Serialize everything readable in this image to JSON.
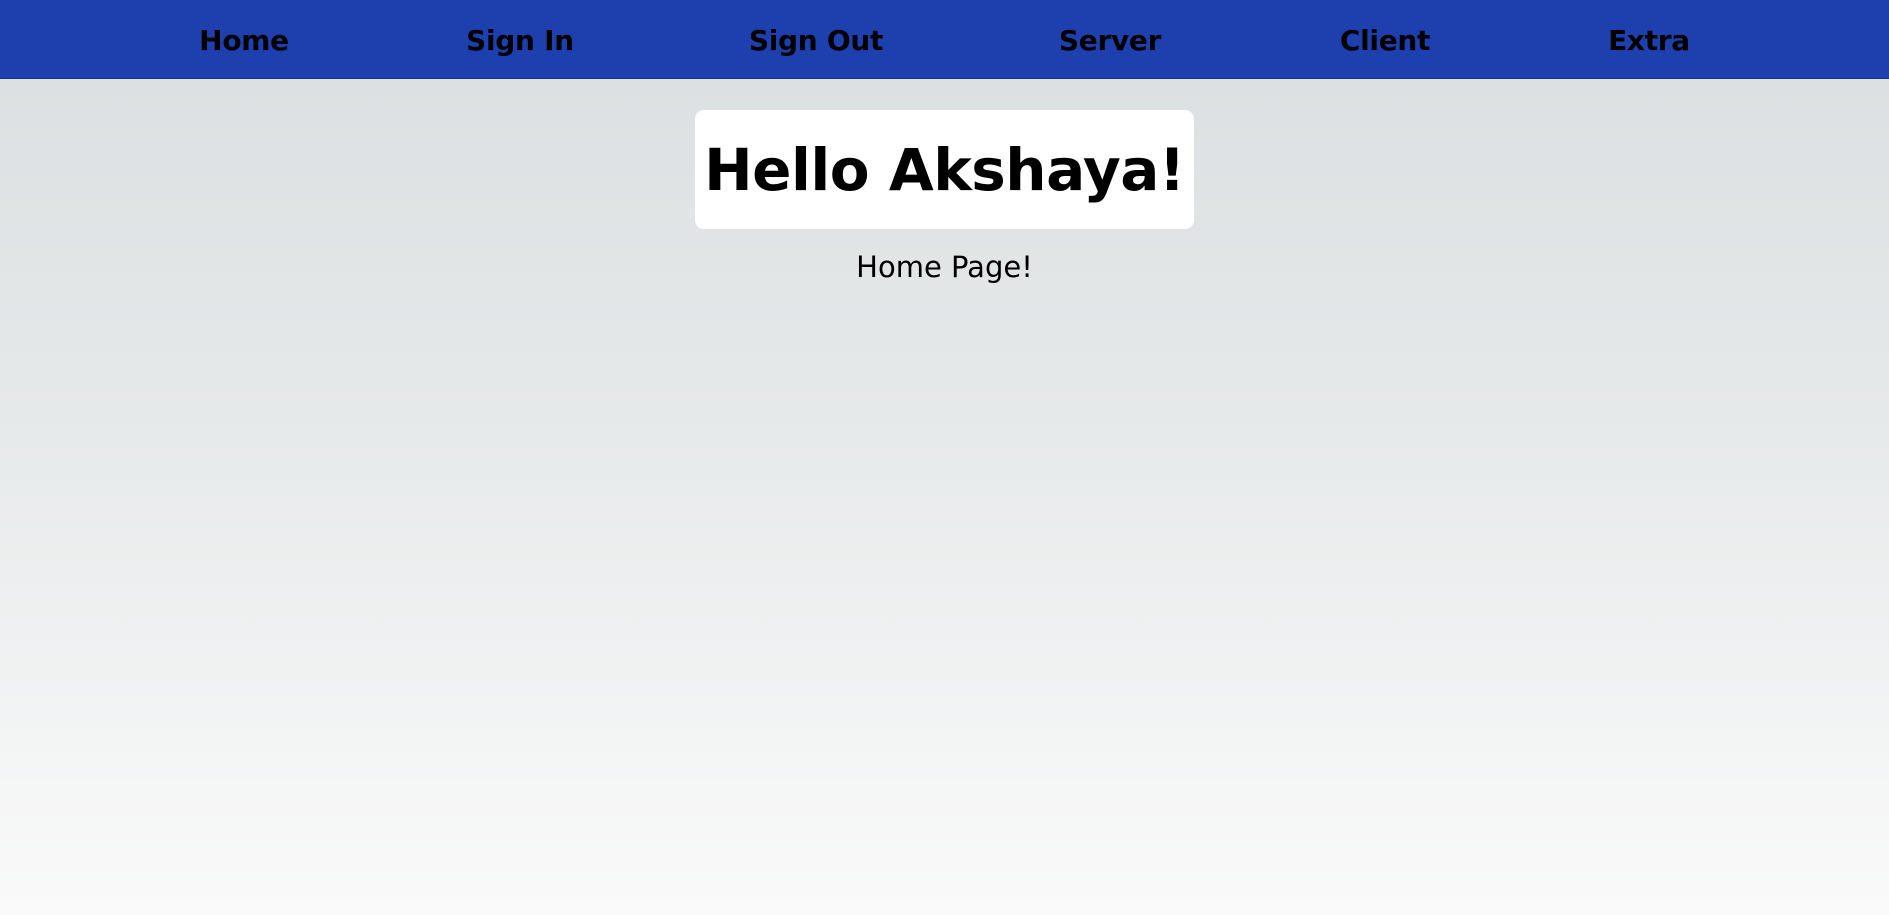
{
  "nav": {
    "items": [
      {
        "label": "Home"
      },
      {
        "label": "Sign In"
      },
      {
        "label": "Sign Out"
      },
      {
        "label": "Server"
      },
      {
        "label": "Client"
      },
      {
        "label": "Extra"
      }
    ]
  },
  "main": {
    "greeting": "Hello Akshaya!",
    "subtitle": "Home Page!"
  },
  "colors": {
    "navbar_background": "#1e40af",
    "card_background": "#ffffff",
    "text": "#000000"
  }
}
